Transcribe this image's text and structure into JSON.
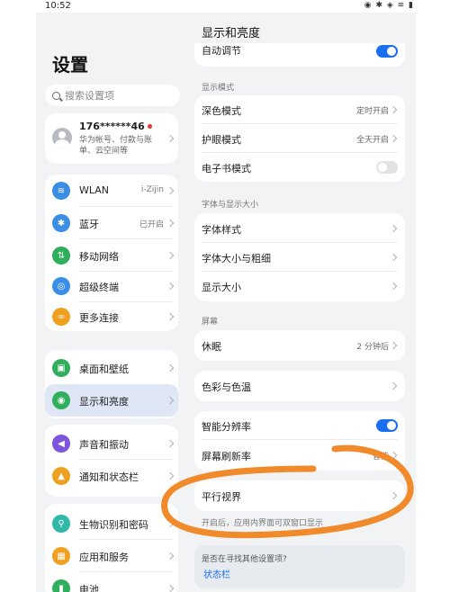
{
  "status_bar": {
    "time": "10:52",
    "icons_text": "◉ ✱ ◈ ≋ ▮"
  },
  "left": {
    "title": "设置",
    "search_placeholder": "搜索设置项",
    "account": {
      "name": "176******46",
      "desc": "华为帐号、付款与账单、云空间等"
    },
    "groups": [
      [
        {
          "icon": "wifi-icon",
          "symbol": "≋",
          "color": "#3a8ee6",
          "label": "WLAN",
          "value": "i-Zijin"
        },
        {
          "icon": "bluetooth-icon",
          "symbol": "✱",
          "color": "#3a8ee6",
          "label": "蓝牙",
          "value": "已开启"
        },
        {
          "icon": "mobile-network-icon",
          "symbol": "⇅",
          "color": "#2fae5c",
          "label": "移动网络",
          "value": ""
        },
        {
          "icon": "super-device-icon",
          "symbol": "◎",
          "color": "#3a8ee6",
          "label": "超级终端",
          "value": ""
        },
        {
          "icon": "more-connections-icon",
          "symbol": "∞",
          "color": "#f0a020",
          "label": "更多连接",
          "value": ""
        }
      ],
      [
        {
          "icon": "wallpaper-icon",
          "symbol": "▣",
          "color": "#2fae5c",
          "label": "桌面和壁纸",
          "value": ""
        },
        {
          "icon": "display-brightness-icon",
          "symbol": "◉",
          "color": "#2fae5c",
          "label": "显示和亮度",
          "value": "",
          "selected": true
        }
      ],
      [
        {
          "icon": "sound-icon",
          "symbol": "◀",
          "color": "#7b55e0",
          "label": "声音和振动",
          "value": ""
        },
        {
          "icon": "notification-icon",
          "symbol": "▲",
          "color": "#f0a020",
          "label": "通知和状态栏",
          "value": ""
        }
      ],
      [
        {
          "icon": "biometrics-icon",
          "symbol": "⚲",
          "color": "#2fb8a8",
          "label": "生物识别和密码",
          "value": ""
        },
        {
          "icon": "apps-icon",
          "symbol": "▦",
          "color": "#f0a020",
          "label": "应用和服务",
          "value": ""
        },
        {
          "icon": "battery-icon",
          "symbol": "▮",
          "color": "#2fae5c",
          "label": "电池",
          "value": ""
        }
      ]
    ]
  },
  "right": {
    "title": "显示和亮度",
    "auto_adjust": "自动调节",
    "sections": {
      "display_mode": "显示模式",
      "font_size": "字体与显示大小",
      "screen": "屏幕"
    },
    "display_mode_rows": [
      {
        "label": "深色模式",
        "value": "定时开启"
      },
      {
        "label": "护眼模式",
        "value": "全天开启"
      },
      {
        "label": "电子书模式",
        "value": ""
      }
    ],
    "font_rows": [
      {
        "label": "字体样式"
      },
      {
        "label": "字体大小与粗细"
      },
      {
        "label": "显示大小"
      }
    ],
    "sleep": {
      "label": "休眠",
      "value": "2 分钟后"
    },
    "color_temp": "色彩与色温",
    "smart_res": "智能分辨率",
    "refresh_rate": {
      "label": "屏幕刷新率",
      "value": "智能"
    },
    "parallel_view": "平行视界",
    "parallel_note": "开启后，应用内界面可双窗口显示",
    "find_question": "是否在寻找其他设置项?",
    "find_link": "状态栏"
  },
  "colors": {
    "accent": "#1a6ef0",
    "annotation": "#f08a2a"
  }
}
